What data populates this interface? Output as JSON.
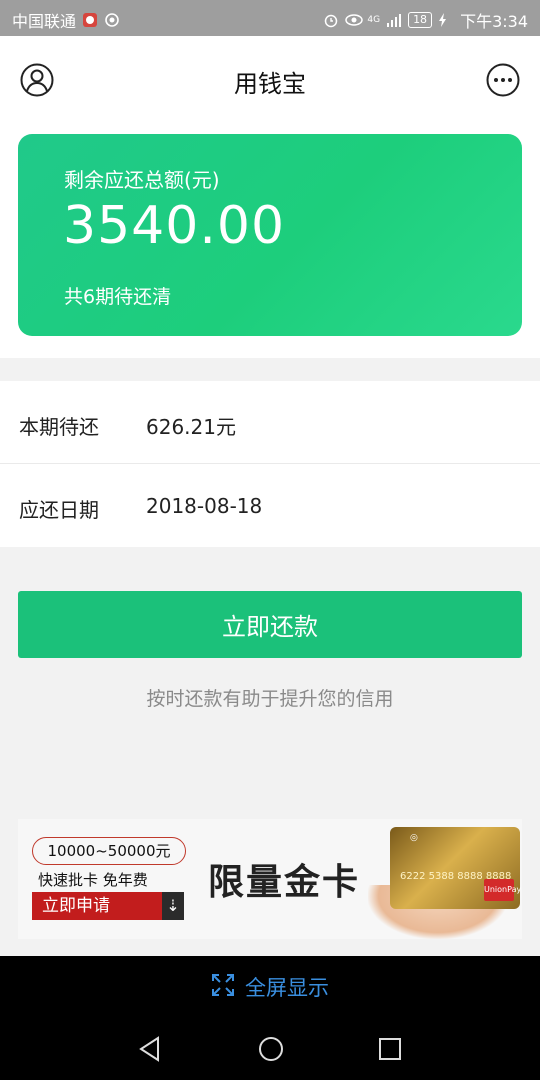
{
  "status_bar": {
    "carrier": "中国联通",
    "network": "4G",
    "battery": "18",
    "time": "下午3:34"
  },
  "header": {
    "title": "用钱宝",
    "left_icon": "user-icon",
    "right_icon": "more-icon"
  },
  "summary": {
    "label": "剩余应还总额(元)",
    "amount": "3540.00",
    "periods_text": "共6期待还清"
  },
  "details": [
    {
      "label": "本期待还",
      "value": "626.21元"
    },
    {
      "label": "应还日期",
      "value": "2018-08-18"
    }
  ],
  "repay_button": "立即还款",
  "hint": "按时还款有助于提升您的信用",
  "ad_banner": {
    "range": "10000~50000元",
    "subtitle": "快速批卡  免年费",
    "apply": "立即申请",
    "title": "限量金卡",
    "card_number": "6222 5388 8888 8888",
    "unionpay": "UnionPay"
  },
  "fullscreen_label": "全屏显示",
  "colors": {
    "accent_green": "#1bc17a",
    "status_bar": "#9e9e9e",
    "fullscreen_blue": "#3a8fe0"
  }
}
